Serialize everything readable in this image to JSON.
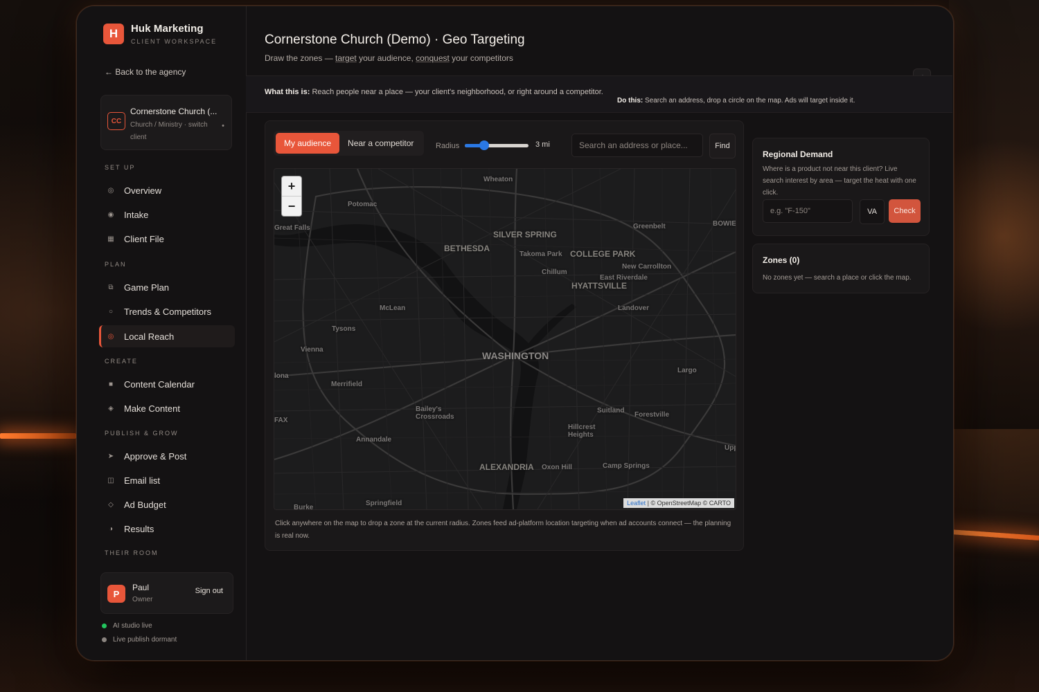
{
  "brand": {
    "logo_letter": "H",
    "name": "Huk Marketing",
    "subtitle": "CLIENT WORKSPACE"
  },
  "back_link": "← Back to the agency",
  "client": {
    "initials": "CC",
    "name": "Cornerstone Church (...",
    "meta": "Church / Ministry · switch client",
    "indicator": "•"
  },
  "nav": {
    "sections": {
      "setup": "SET UP",
      "plan": "PLAN",
      "create": "CREATE",
      "publish": "PUBLISH & GROW",
      "their_room": "THEIR ROOM"
    },
    "items": [
      {
        "label": "Overview",
        "icon": "target-icon",
        "glyph": "◎"
      },
      {
        "label": "Intake",
        "icon": "radio-icon",
        "glyph": "◉"
      },
      {
        "label": "Client File",
        "icon": "file-icon",
        "glyph": "▦"
      },
      {
        "label": "Game Plan",
        "icon": "copy-icon",
        "glyph": "⧉"
      },
      {
        "label": "Trends & Competitors",
        "icon": "circle-icon",
        "glyph": "○"
      },
      {
        "label": "Local Reach",
        "icon": "location-target-icon",
        "glyph": "◎"
      },
      {
        "label": "Content Calendar",
        "icon": "calendar-icon",
        "glyph": "■"
      },
      {
        "label": "Make Content",
        "icon": "sparkle-icon",
        "glyph": "◈"
      },
      {
        "label": "Approve & Post",
        "icon": "send-icon",
        "glyph": "➤"
      },
      {
        "label": "Email list",
        "icon": "mail-icon",
        "glyph": "◫"
      },
      {
        "label": "Ad Budget",
        "icon": "diamond-icon",
        "glyph": "◇"
      },
      {
        "label": "Results",
        "icon": "chart-half-icon",
        "glyph": "◑"
      }
    ],
    "active": "Local Reach"
  },
  "user": {
    "initial": "P",
    "name": "Paul",
    "role": "Owner",
    "sign_out": "Sign out"
  },
  "status": [
    {
      "label": "AI studio live",
      "color": "#22c55e"
    },
    {
      "label": "Live publish dormant",
      "color": "#8b8580"
    }
  ],
  "header": {
    "title": "Cornerstone Church (Demo) · Geo Targeting",
    "sub_prefix": "Draw the zones — ",
    "sub_target": "target",
    "sub_mid": " your audience, ",
    "sub_conquest": "conquest",
    "sub_end": " your competitors",
    "refresh_glyph": "⟲"
  },
  "info": {
    "what_label": "What this is:",
    "what_text": " Reach people near a place — your client's neighborhood, or right around a competitor.",
    "do_label": "Do this:",
    "do_text": " Search an address, drop a circle on the map. Ads will target inside it."
  },
  "map_controls": {
    "tabs": [
      "My audience",
      "Near a competitor"
    ],
    "active_tab": "My audience",
    "radius_label": "Radius",
    "radius_value": "3 mi",
    "radius_fraction": 0.3,
    "search_placeholder": "Search an address or place...",
    "find_label": "Find",
    "zoom_in": "+",
    "zoom_out": "−"
  },
  "map_labels": [
    "Wheaton",
    "Potomac",
    "Great Falls",
    "Greenbelt",
    "BOWIE",
    "SILVER SPRING",
    "BETHESDA",
    "Takoma Park",
    "COLLEGE PARK",
    "New Carrollton",
    "Chillum",
    "East Riverdale",
    "HYATTSVILLE",
    "McLean",
    "Landover",
    "Tysons",
    "Vienna",
    "WASHINGTON",
    "Largo",
    "Merrifield",
    "Bailey's Crossroads",
    "Suitland",
    "Forestville",
    "Hillcrest Heights",
    "Annandale",
    "ALEXANDRIA",
    "Oxon Hill",
    "Camp Springs",
    "Springfield",
    "Burke",
    "FAX",
    "Upp",
    "lona"
  ],
  "attribution": {
    "leaflet": "Leaflet",
    "rest": " | © OpenStreetMap © CARTO"
  },
  "map_note": "Click anywhere on the map to drop a zone at the current radius. Zones feed ad-platform location targeting when ad accounts connect — the planning is real now.",
  "regional": {
    "title": "Regional Demand",
    "text": "Where is a product not near this client? Live search interest by area — target the heat with one click.",
    "placeholder": "e.g. \"F-150\"",
    "state": "VA",
    "check": "Check"
  },
  "zones": {
    "title": "Zones (0)",
    "text": "No zones yet — search a place or click the map."
  },
  "colors": {
    "accent": "#e8563a",
    "slider": "#2a78e4",
    "map_bg": "#1b1b1c"
  }
}
